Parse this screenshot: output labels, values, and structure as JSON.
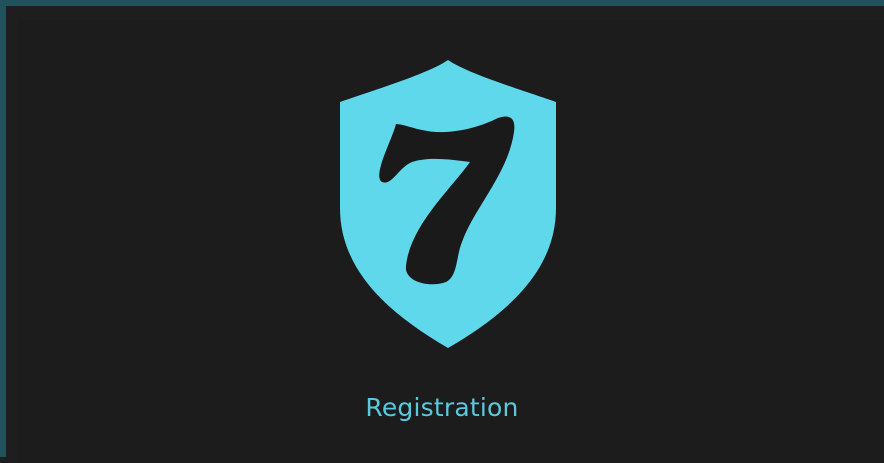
{
  "app": {
    "logo_icon": "shield-seven-logo-icon",
    "logo_mark": "7",
    "label": "Registration"
  },
  "colors": {
    "frame_border": "#21525c",
    "background": "#1c1c1c",
    "accent": "#5fd8eb",
    "label": "#5bc8de",
    "logo_glyph": "#1a1a1a"
  }
}
